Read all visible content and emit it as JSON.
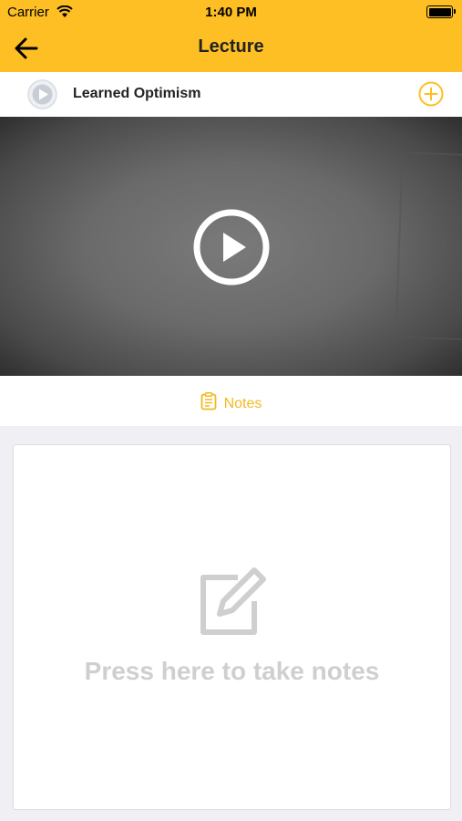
{
  "status_bar": {
    "carrier": "Carrier",
    "time": "1:40 PM"
  },
  "nav": {
    "title": "Lecture",
    "back_icon": "arrow-left-icon"
  },
  "lecture": {
    "title": "Learned Optimism",
    "play_icon": "play-circle-icon",
    "add_icon": "plus-circle-icon"
  },
  "video": {
    "play_icon": "play-circle-icon"
  },
  "tabs": {
    "notes_label": "Notes"
  },
  "notes": {
    "placeholder": "Press here to take notes",
    "icon": "edit-note-icon"
  },
  "colors": {
    "accent": "#fdbf24",
    "notes_tab": "#f2b91f",
    "hint_text": "#cfcfcf"
  }
}
